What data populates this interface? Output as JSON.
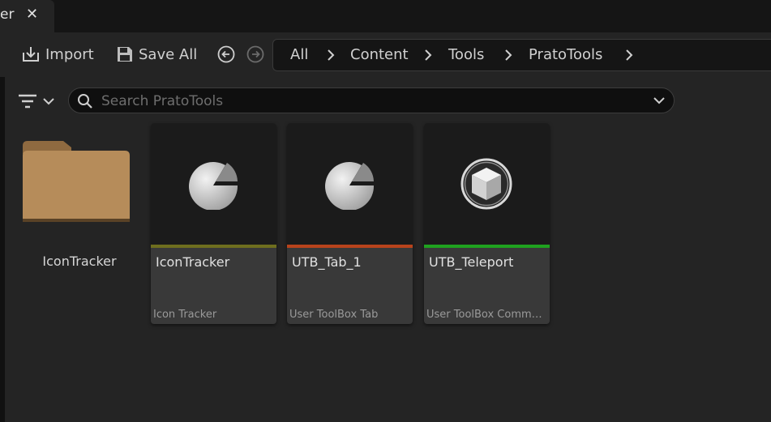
{
  "tab": {
    "title": "er",
    "close_label": "✕"
  },
  "toolbar": {
    "import_label": "Import",
    "save_all_label": "Save All"
  },
  "breadcrumb": [
    "All",
    "Content",
    "Tools",
    "PratoTools"
  ],
  "search": {
    "placeholder": "Search PratoTools",
    "value": ""
  },
  "folders": [
    {
      "label": "IconTracker"
    }
  ],
  "assets": [
    {
      "name": "IconTracker",
      "type": "Icon Tracker",
      "accent": "#6e6e1e",
      "icon": "pie-chart-icon"
    },
    {
      "name": "UTB_Tab_1",
      "type": "User ToolBox Tab",
      "accent": "#b8431c",
      "icon": "pie-chart-icon"
    },
    {
      "name": "UTB_Teleport",
      "type": "User ToolBox Comma...",
      "accent": "#1fa11f",
      "icon": "cube-icon"
    }
  ],
  "colors": {
    "background": "#242424",
    "tab_bar": "#151515",
    "card": "#393939",
    "thumb": "#1b1b1b",
    "folder": "#b68c5a"
  }
}
